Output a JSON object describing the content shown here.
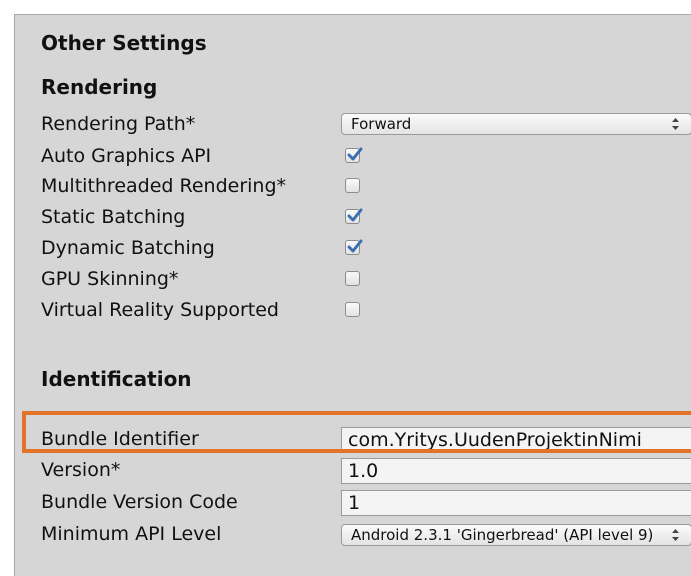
{
  "section_title": "Other Settings",
  "rendering": {
    "heading": "Rendering",
    "rendering_path": {
      "label": "Rendering Path*",
      "value": "Forward"
    },
    "auto_graphics_api": {
      "label": "Auto Graphics API",
      "checked": true
    },
    "multithreaded_rendering": {
      "label": "Multithreaded Rendering*",
      "checked": false
    },
    "static_batching": {
      "label": "Static Batching",
      "checked": true
    },
    "dynamic_batching": {
      "label": "Dynamic Batching",
      "checked": true
    },
    "gpu_skinning": {
      "label": "GPU Skinning*",
      "checked": false
    },
    "vr_supported": {
      "label": "Virtual Reality Supported",
      "checked": false
    }
  },
  "identification": {
    "heading": "Identification",
    "bundle_identifier": {
      "label": "Bundle Identifier",
      "value": "com.Yritys.UudenProjektinNimi"
    },
    "version": {
      "label": "Version*",
      "value": "1.0"
    },
    "bundle_version_code": {
      "label": "Bundle Version Code",
      "value": "1"
    },
    "min_api_level": {
      "label": "Minimum API Level",
      "value": "Android 2.3.1 'Gingerbread' (API level 9)"
    }
  },
  "colors": {
    "panel_bg": "#d6d6d6",
    "highlight": "#e3722b",
    "check": "#3c6fb0"
  }
}
